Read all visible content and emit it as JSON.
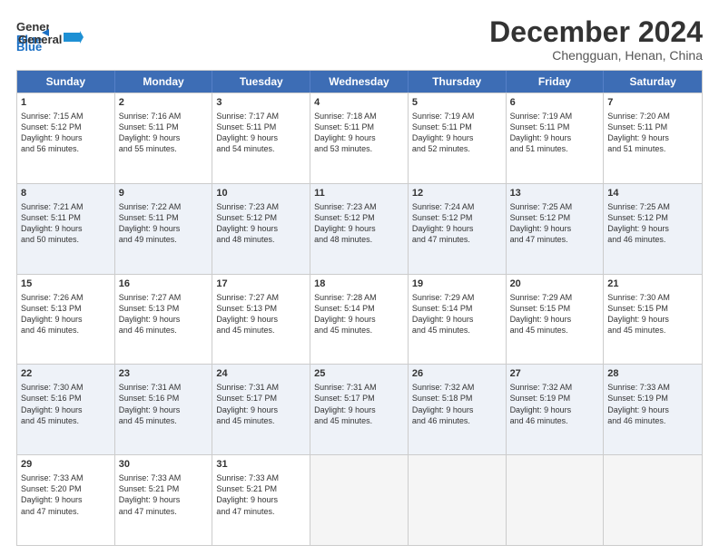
{
  "logo": {
    "line1": "General",
    "line2": "Blue"
  },
  "title": "December 2024",
  "subtitle": "Chengguan, Henan, China",
  "days": [
    "Sunday",
    "Monday",
    "Tuesday",
    "Wednesday",
    "Thursday",
    "Friday",
    "Saturday"
  ],
  "rows": [
    [
      {
        "day": "1",
        "lines": [
          "Sunrise: 7:15 AM",
          "Sunset: 5:12 PM",
          "Daylight: 9 hours",
          "and 56 minutes."
        ]
      },
      {
        "day": "2",
        "lines": [
          "Sunrise: 7:16 AM",
          "Sunset: 5:11 PM",
          "Daylight: 9 hours",
          "and 55 minutes."
        ]
      },
      {
        "day": "3",
        "lines": [
          "Sunrise: 7:17 AM",
          "Sunset: 5:11 PM",
          "Daylight: 9 hours",
          "and 54 minutes."
        ]
      },
      {
        "day": "4",
        "lines": [
          "Sunrise: 7:18 AM",
          "Sunset: 5:11 PM",
          "Daylight: 9 hours",
          "and 53 minutes."
        ]
      },
      {
        "day": "5",
        "lines": [
          "Sunrise: 7:19 AM",
          "Sunset: 5:11 PM",
          "Daylight: 9 hours",
          "and 52 minutes."
        ]
      },
      {
        "day": "6",
        "lines": [
          "Sunrise: 7:19 AM",
          "Sunset: 5:11 PM",
          "Daylight: 9 hours",
          "and 51 minutes."
        ]
      },
      {
        "day": "7",
        "lines": [
          "Sunrise: 7:20 AM",
          "Sunset: 5:11 PM",
          "Daylight: 9 hours",
          "and 51 minutes."
        ]
      }
    ],
    [
      {
        "day": "8",
        "lines": [
          "Sunrise: 7:21 AM",
          "Sunset: 5:11 PM",
          "Daylight: 9 hours",
          "and 50 minutes."
        ]
      },
      {
        "day": "9",
        "lines": [
          "Sunrise: 7:22 AM",
          "Sunset: 5:11 PM",
          "Daylight: 9 hours",
          "and 49 minutes."
        ]
      },
      {
        "day": "10",
        "lines": [
          "Sunrise: 7:23 AM",
          "Sunset: 5:12 PM",
          "Daylight: 9 hours",
          "and 48 minutes."
        ]
      },
      {
        "day": "11",
        "lines": [
          "Sunrise: 7:23 AM",
          "Sunset: 5:12 PM",
          "Daylight: 9 hours",
          "and 48 minutes."
        ]
      },
      {
        "day": "12",
        "lines": [
          "Sunrise: 7:24 AM",
          "Sunset: 5:12 PM",
          "Daylight: 9 hours",
          "and 47 minutes."
        ]
      },
      {
        "day": "13",
        "lines": [
          "Sunrise: 7:25 AM",
          "Sunset: 5:12 PM",
          "Daylight: 9 hours",
          "and 47 minutes."
        ]
      },
      {
        "day": "14",
        "lines": [
          "Sunrise: 7:25 AM",
          "Sunset: 5:12 PM",
          "Daylight: 9 hours",
          "and 46 minutes."
        ]
      }
    ],
    [
      {
        "day": "15",
        "lines": [
          "Sunrise: 7:26 AM",
          "Sunset: 5:13 PM",
          "Daylight: 9 hours",
          "and 46 minutes."
        ]
      },
      {
        "day": "16",
        "lines": [
          "Sunrise: 7:27 AM",
          "Sunset: 5:13 PM",
          "Daylight: 9 hours",
          "and 46 minutes."
        ]
      },
      {
        "day": "17",
        "lines": [
          "Sunrise: 7:27 AM",
          "Sunset: 5:13 PM",
          "Daylight: 9 hours",
          "and 45 minutes."
        ]
      },
      {
        "day": "18",
        "lines": [
          "Sunrise: 7:28 AM",
          "Sunset: 5:14 PM",
          "Daylight: 9 hours",
          "and 45 minutes."
        ]
      },
      {
        "day": "19",
        "lines": [
          "Sunrise: 7:29 AM",
          "Sunset: 5:14 PM",
          "Daylight: 9 hours",
          "and 45 minutes."
        ]
      },
      {
        "day": "20",
        "lines": [
          "Sunrise: 7:29 AM",
          "Sunset: 5:15 PM",
          "Daylight: 9 hours",
          "and 45 minutes."
        ]
      },
      {
        "day": "21",
        "lines": [
          "Sunrise: 7:30 AM",
          "Sunset: 5:15 PM",
          "Daylight: 9 hours",
          "and 45 minutes."
        ]
      }
    ],
    [
      {
        "day": "22",
        "lines": [
          "Sunrise: 7:30 AM",
          "Sunset: 5:16 PM",
          "Daylight: 9 hours",
          "and 45 minutes."
        ]
      },
      {
        "day": "23",
        "lines": [
          "Sunrise: 7:31 AM",
          "Sunset: 5:16 PM",
          "Daylight: 9 hours",
          "and 45 minutes."
        ]
      },
      {
        "day": "24",
        "lines": [
          "Sunrise: 7:31 AM",
          "Sunset: 5:17 PM",
          "Daylight: 9 hours",
          "and 45 minutes."
        ]
      },
      {
        "day": "25",
        "lines": [
          "Sunrise: 7:31 AM",
          "Sunset: 5:17 PM",
          "Daylight: 9 hours",
          "and 45 minutes."
        ]
      },
      {
        "day": "26",
        "lines": [
          "Sunrise: 7:32 AM",
          "Sunset: 5:18 PM",
          "Daylight: 9 hours",
          "and 46 minutes."
        ]
      },
      {
        "day": "27",
        "lines": [
          "Sunrise: 7:32 AM",
          "Sunset: 5:19 PM",
          "Daylight: 9 hours",
          "and 46 minutes."
        ]
      },
      {
        "day": "28",
        "lines": [
          "Sunrise: 7:33 AM",
          "Sunset: 5:19 PM",
          "Daylight: 9 hours",
          "and 46 minutes."
        ]
      }
    ],
    [
      {
        "day": "29",
        "lines": [
          "Sunrise: 7:33 AM",
          "Sunset: 5:20 PM",
          "Daylight: 9 hours",
          "and 47 minutes."
        ]
      },
      {
        "day": "30",
        "lines": [
          "Sunrise: 7:33 AM",
          "Sunset: 5:21 PM",
          "Daylight: 9 hours",
          "and 47 minutes."
        ]
      },
      {
        "day": "31",
        "lines": [
          "Sunrise: 7:33 AM",
          "Sunset: 5:21 PM",
          "Daylight: 9 hours",
          "and 47 minutes."
        ]
      },
      {
        "day": "",
        "lines": []
      },
      {
        "day": "",
        "lines": []
      },
      {
        "day": "",
        "lines": []
      },
      {
        "day": "",
        "lines": []
      }
    ]
  ]
}
